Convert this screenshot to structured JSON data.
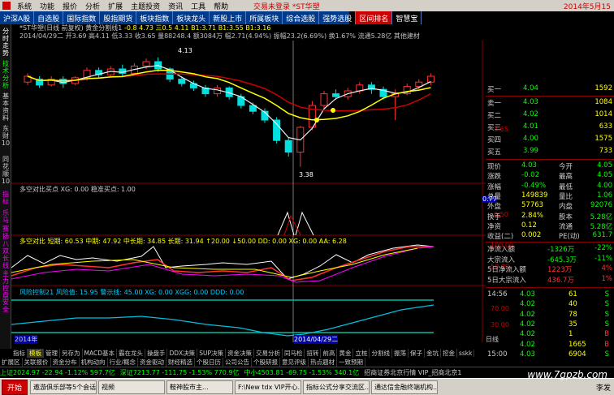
{
  "menubar": {
    "items": [
      "系统",
      "功能",
      "报价",
      "分析",
      "扩展",
      "主题投资",
      "资讯",
      "工具",
      "帮助"
    ],
    "title": "交易未登录 *ST华塑",
    "date": "2014年5月15"
  },
  "toolbar": {
    "tabs": [
      "沪深A股",
      "自选股",
      "国际指数",
      "股指期货",
      "板块指数",
      "板块龙头",
      "新股上市",
      "所属板块",
      "综合选股",
      "强势选股",
      "区间排名",
      "智慧宝"
    ]
  },
  "leftnav": {
    "items": [
      "分时走势",
      "技术分析",
      "基本资料",
      "东财10",
      "同花顺10",
      "指标",
      "乐马",
      "赛扬",
      "八双",
      "长线",
      "主力控盘",
      "安全"
    ]
  },
  "chart": {
    "header1": "*ST华塑(日线 前复权) 黄金分割线1",
    "header1_vals": "-0.8 4.73  三0.5 4.11  B1:3.71  B1:3.55  B1:3.16",
    "header2": "2014/04/29二 开3.69 高4.11 低3.33 收3.65 量88248.4 额3084万 幅2.71(4.94%) 振幅23.2(6.69%) 换1.67% 流通5.28亿 其他建材",
    "price_labels": [
      "4.13",
      "3.65",
      "3.38"
    ],
    "panel2_title": "多空对比买点 XG: 0.00  稳准买点: 1.00",
    "panel2_right": [
      "0.77",
      "0.50"
    ],
    "panel3_title": "多空对比 短期: 60.53  中期: 47.92  中长期: 34.85  长期: 31.94  ↑20.00  ↓50.00  DD: 0.00  XG: 0.00  AA: 6.28",
    "panel3_right": [
      "100.00",
      "50.00"
    ],
    "panel4_title": "风险控制21  风险值: 15.95  警示线: 45.00  XG: 0.00  XGG: 0.00  DDD: 0.00",
    "panel4_right": [
      "70.00",
      "30.00"
    ],
    "x_labels": [
      "2014年",
      "2014/04/29二"
    ],
    "x_right": "日线"
  },
  "chart_data": {
    "type": "candlestick",
    "title": "*ST华塑(日线 前复权)",
    "dates_shown": [
      "2014年",
      "2014/04/29二"
    ],
    "price_labels": [
      4.13,
      3.65,
      3.38
    ],
    "candles": [
      {
        "o": 3.96,
        "c": 4.0,
        "h": 4.02,
        "l": 3.94
      },
      {
        "o": 3.98,
        "c": 3.94,
        "h": 4.0,
        "l": 3.92
      },
      {
        "o": 3.94,
        "c": 3.98,
        "h": 4.0,
        "l": 3.93
      },
      {
        "o": 3.98,
        "c": 3.95,
        "h": 4.0,
        "l": 3.92
      },
      {
        "o": 3.95,
        "c": 3.99,
        "h": 4.0,
        "l": 3.94
      },
      {
        "o": 3.99,
        "c": 4.04,
        "h": 4.06,
        "l": 3.97
      },
      {
        "o": 4.04,
        "c": 4.01,
        "h": 4.06,
        "l": 3.99
      },
      {
        "o": 4.01,
        "c": 4.05,
        "h": 4.07,
        "l": 4.0
      },
      {
        "o": 4.05,
        "c": 4.02,
        "h": 4.08,
        "l": 4.0
      },
      {
        "o": 4.02,
        "c": 4.07,
        "h": 4.09,
        "l": 4.01
      },
      {
        "o": 4.07,
        "c": 4.1,
        "h": 4.12,
        "l": 4.05
      },
      {
        "o": 4.1,
        "c": 4.05,
        "h": 4.13,
        "l": 4.03
      },
      {
        "o": 4.05,
        "c": 3.98,
        "h": 4.06,
        "l": 3.96
      },
      {
        "o": 3.98,
        "c": 3.95,
        "h": 4.0,
        "l": 3.93
      },
      {
        "o": 3.95,
        "c": 3.92,
        "h": 3.97,
        "l": 3.9
      },
      {
        "o": 3.92,
        "c": 3.88,
        "h": 3.94,
        "l": 3.86
      },
      {
        "o": 3.88,
        "c": 3.92,
        "h": 3.94,
        "l": 3.86
      },
      {
        "o": 3.92,
        "c": 3.86,
        "h": 3.93,
        "l": 3.84
      },
      {
        "o": 3.86,
        "c": 3.8,
        "h": 3.88,
        "l": 3.78
      },
      {
        "o": 3.8,
        "c": 3.76,
        "h": 3.82,
        "l": 3.74
      },
      {
        "o": 3.76,
        "c": 3.7,
        "h": 3.78,
        "l": 3.68
      },
      {
        "o": 3.7,
        "c": 3.56,
        "h": 3.72,
        "l": 3.54
      },
      {
        "o": 3.56,
        "c": 3.48,
        "h": 3.58,
        "l": 3.45
      },
      {
        "o": 3.48,
        "c": 3.65,
        "h": 3.66,
        "l": 3.38
      },
      {
        "o": 3.65,
        "c": 3.8,
        "h": 3.83,
        "l": 3.63
      },
      {
        "o": 3.8,
        "c": 3.88,
        "h": 3.9,
        "l": 3.78
      },
      {
        "o": 3.88,
        "c": 3.86,
        "h": 3.91,
        "l": 3.84
      },
      {
        "o": 3.86,
        "c": 3.9,
        "h": 3.92,
        "l": 3.84
      },
      {
        "o": 3.9,
        "c": 3.94,
        "h": 3.96,
        "l": 3.88
      },
      {
        "o": 3.94,
        "c": 3.91,
        "h": 3.96,
        "l": 3.88
      },
      {
        "o": 3.91,
        "c": 3.86,
        "h": 3.93,
        "l": 3.84
      },
      {
        "o": 3.86,
        "c": 3.88,
        "h": 3.91,
        "l": 3.7
      },
      {
        "o": 3.88,
        "c": 3.93,
        "h": 3.95,
        "l": 3.87
      },
      {
        "o": 3.93,
        "c": 3.96,
        "h": 3.98,
        "l": 3.91
      },
      {
        "o": 3.96,
        "c": 4.0,
        "h": 4.02,
        "l": 3.94
      }
    ],
    "ylim": [
      3.3,
      4.2
    ]
  },
  "quote": {
    "sells": [
      {
        "label": "卖一",
        "price": "4.03",
        "vol": "1084"
      },
      {
        "label": "买二",
        "price": "4.02",
        "vol": "1014"
      },
      {
        "label": "买三",
        "price": "4.01",
        "vol": "633"
      },
      {
        "label": "买四",
        "price": "4.00",
        "vol": "1575"
      },
      {
        "label": "买五",
        "price": "3.99",
        "vol": "733"
      }
    ],
    "top_row": {
      "label": "买一",
      "price": "4.04",
      "vol": "1592"
    },
    "stats": [
      {
        "k1": "现价",
        "v1": "4.03",
        "k2": "今开",
        "v2": "4.05"
      },
      {
        "k1": "涨跌",
        "v1": "-0.02",
        "k2": "最高",
        "v2": "4.05"
      },
      {
        "k1": "涨幅",
        "v1": "-0.49%",
        "k2": "最低",
        "v2": "4.00"
      },
      {
        "k1": "总量",
        "v1": "149839",
        "k2": "量比",
        "v2": "1.06"
      },
      {
        "k1": "外盘",
        "v1": "57763",
        "k2": "内盘",
        "v2": "92076"
      },
      {
        "k1": "换手",
        "v1": "2.84%",
        "k2": "股本",
        "v2": "5.28亿"
      },
      {
        "k1": "净资",
        "v1": "0.12",
        "k2": "流通",
        "v2": "5.28亿"
      },
      {
        "k1": "收益(二)",
        "v1": "0.002",
        "k2": "PE(动)",
        "v2": "631.7"
      }
    ],
    "flows": [
      {
        "k": "净流入额",
        "v": "-1326万",
        "p": "-22%"
      },
      {
        "k": "大宗流入",
        "v": "-645.3万",
        "p": "-11%"
      },
      {
        "k": "5日净流入额",
        "v": "1223万",
        "p": "4%"
      },
      {
        "k": "5日大宗流入",
        "v": "436.7万",
        "p": "1%"
      }
    ],
    "ticks": [
      {
        "t": "14:56",
        "p": "4.03",
        "v": "61",
        "s": "S"
      },
      {
        "t": "",
        "p": "4.02",
        "v": "40",
        "s": "S"
      },
      {
        "t": "",
        "p": "4.02",
        "v": "78",
        "s": "S"
      },
      {
        "t": "",
        "p": "4.02",
        "v": "35",
        "s": "S"
      },
      {
        "t": "",
        "p": "4.02",
        "v": "1",
        "s": "B"
      },
      {
        "t": "",
        "p": "4.02",
        "v": "1665",
        "s": "B"
      },
      {
        "t": "15:00",
        "p": "4.03",
        "v": "6904",
        "s": "S"
      }
    ]
  },
  "bottomtabs": [
    "指标",
    "模板",
    "管理",
    "另存为",
    "MACD基本",
    "霸在龙头",
    "操盘手",
    "DDX决策",
    "SUP决策",
    "资金决策",
    "交易分析",
    "同马检",
    "扭转",
    "前高",
    "黄金",
    "立桩",
    "分割线",
    "振荡",
    "保子",
    "金坑",
    "挖金",
    "sskk"
  ],
  "tabs2": [
    "扩展区",
    "关联报价",
    "资金分布",
    "机构动向",
    "行业/概念",
    "资金驱动",
    "财经精选",
    "个股日历",
    "公司公告",
    "个股研报",
    "意见评级",
    "热点题材",
    "一致预期"
  ],
  "status": {
    "seg1": "上证2024.97  -22.94  -1.12%  597.7亿",
    "seg2": "深证7213.77  -111.75  -1.53%  770.9亿",
    "seg3": "中小4503.81  -69.75  -1.53%  340.1亿",
    "seg4": "招商证券北京行情 VIP_招商北京1"
  },
  "taskbar": {
    "start": "开始",
    "tasks": [
      "遨游俱乐部等5个会话",
      "视频",
      "鞍神股市主...",
      "F:\\New tdx VIP开心...",
      "指标公式分享交流区...",
      "通达信金融终端机构..."
    ],
    "tray": "李发"
  },
  "watermark": "www.7gpzb.com",
  "colors": {
    "up": "#ff3232",
    "down": "#00e0e0",
    "bg": "#000000",
    "toolbar": "#003a8c"
  }
}
